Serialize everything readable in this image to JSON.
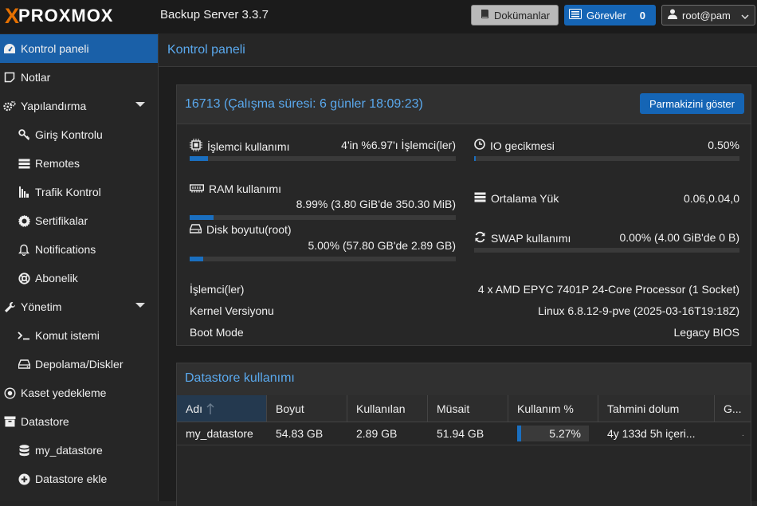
{
  "header": {
    "logo_x": "X",
    "logo_text": "PROXMOX",
    "product": "Backup Server 3.3.7",
    "docs_label": "Dokümanlar",
    "tasks_label": "Görevler",
    "tasks_count": "0",
    "user_label": "root@pam"
  },
  "sidebar": {
    "items": [
      {
        "label": "Kontrol paneli",
        "icon": "dashboard-icon"
      },
      {
        "label": "Notlar",
        "icon": "note-icon"
      },
      {
        "label": "Yapılandırma",
        "icon": "gears-icon"
      },
      {
        "label": "Giriş Kontrolu",
        "icon": "key-icon"
      },
      {
        "label": "Remotes",
        "icon": "server-icon"
      },
      {
        "label": "Trafik Kontrol",
        "icon": "bars-icon"
      },
      {
        "label": "Sertifikalar",
        "icon": "certificate-icon"
      },
      {
        "label": "Notifications",
        "icon": "bell-icon"
      },
      {
        "label": "Abonelik",
        "icon": "support-icon"
      },
      {
        "label": "Yönetim",
        "icon": "wrench-icon"
      },
      {
        "label": "Komut istemi",
        "icon": "terminal-icon"
      },
      {
        "label": "Depolama/Diskler",
        "icon": "hdd-icon"
      },
      {
        "label": "Kaset yedekleme",
        "icon": "tape-icon"
      },
      {
        "label": "Datastore",
        "icon": "archive-icon"
      },
      {
        "label": "my_datastore",
        "icon": "database-icon"
      },
      {
        "label": "Datastore ekle",
        "icon": "plus-circle-icon"
      }
    ]
  },
  "content": {
    "title": "Kontrol paneli"
  },
  "status_panel": {
    "title": "16713 (Çalışma süresi: 6 günler 18:09:23)",
    "fingerprint_button": "Parmakizini göster",
    "cpu": {
      "label": "İşlemci kullanımı",
      "value": "4'in %6.97'ı İşlemci(ler)",
      "fraction": 0.0697
    },
    "io": {
      "label": "IO gecikmesi",
      "value": "0.50%",
      "fraction": 0.005
    },
    "ram": {
      "label": "RAM kullanımı",
      "value": "8.99% (3.80 GiB'de 350.30 MiB)",
      "fraction": 0.0899
    },
    "load": {
      "label": "Ortalama Yük",
      "value": "0.06,0.04,0"
    },
    "disk": {
      "label": "Disk boyutu(root)",
      "value": "5.00% (57.80 GB'de 2.89 GB)",
      "fraction": 0.05
    },
    "swap": {
      "label": "SWAP kullanımı",
      "value": "0.00% (4.00 GiB'de 0 B)",
      "fraction": 0.0
    },
    "cpu_model_label": "İşlemci(ler)",
    "cpu_model_value": "4 x AMD EPYC 7401P 24-Core Processor (1 Socket)",
    "kernel_label": "Kernel Versiyonu",
    "kernel_value": "Linux 6.8.12-9-pve (2025-03-16T19:18Z)",
    "boot_label": "Boot Mode",
    "boot_value": "Legacy BIOS"
  },
  "datastore_panel": {
    "title": "Datastore kullanımı",
    "columns": [
      "Adı",
      "Boyut",
      "Kullanılan",
      "Müsait",
      "Kullanım %",
      "Tahmini dolum",
      "G..."
    ],
    "rows": [
      {
        "name": "my_datastore",
        "size": "54.83 GB",
        "used": "2.89 GB",
        "avail": "51.94 GB",
        "usage": "5.27%",
        "usage_fraction": 0.0527,
        "estimate": "4y 133d 5h içeri...",
        "extra": "."
      }
    ]
  },
  "colors": {
    "accent": "#1565b5",
    "title_blue": "#5aa9ee",
    "logo_orange": "#e57000"
  }
}
